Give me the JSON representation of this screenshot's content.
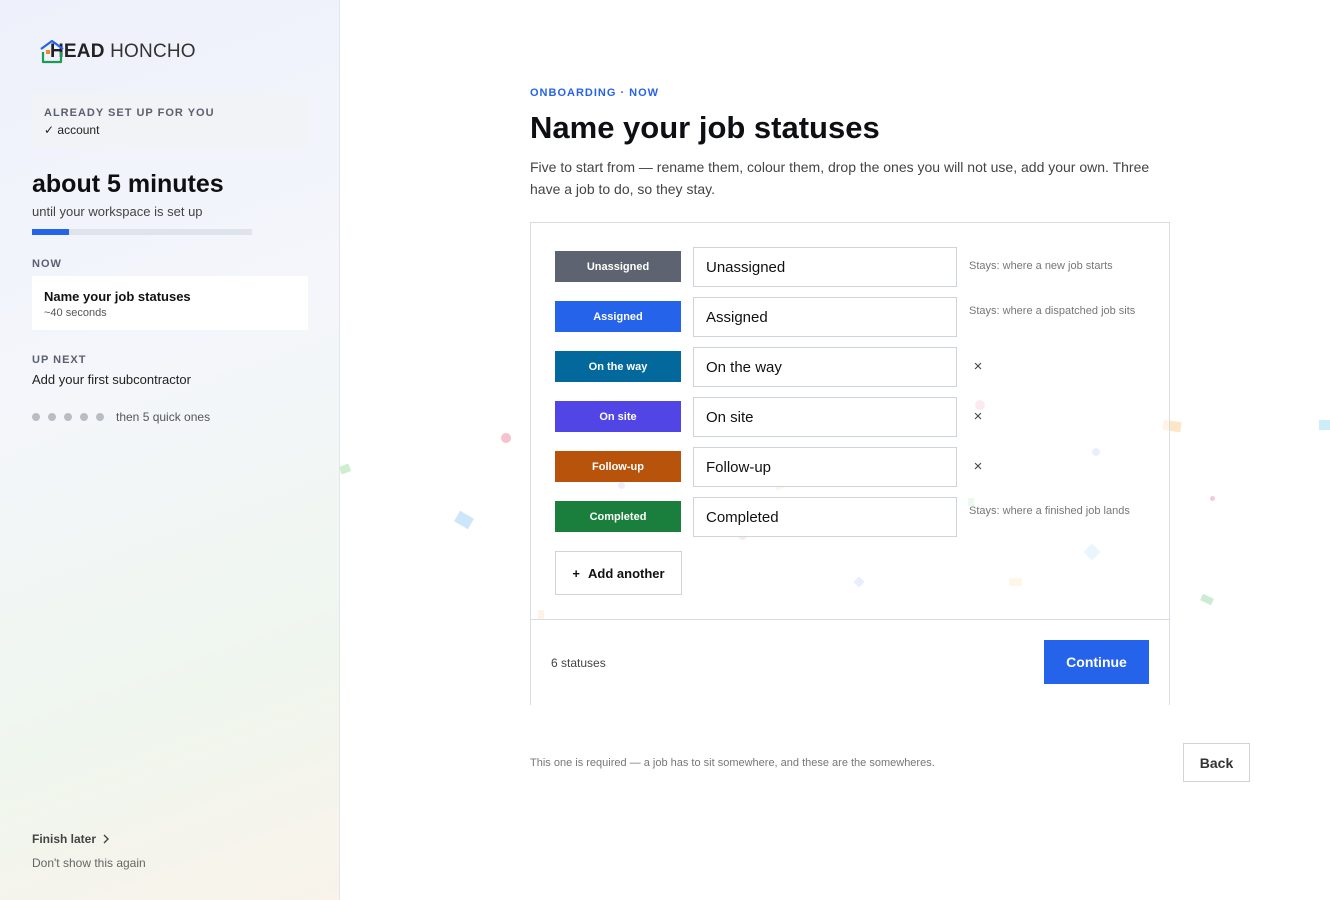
{
  "brand": {
    "bold": "HEAD",
    "light": " HONCHO"
  },
  "sidebar": {
    "setup_caption": "ALREADY SET UP FOR YOU",
    "setup_items": [
      "✓ account"
    ],
    "time_estimate": "about 5 minutes",
    "time_sub": "until your workspace is set up",
    "progress": 0.17,
    "now_caption": "NOW",
    "now_title": "Name your job statuses",
    "now_time": "~40 seconds",
    "next_caption": "UP NEXT",
    "next_title": "Add your first subcontractor",
    "remaining_text": "then 5 quick ones",
    "finish_later": "Finish later",
    "dont_show": "Don't show this again"
  },
  "main": {
    "eyebrow": "ONBOARDING · NOW",
    "title": "Name your job statuses",
    "description": "Five to start from — rename them, colour them, drop the ones you will not use, add your own. Three have a job to do, so they stay.",
    "statuses": [
      {
        "chip": "Unassigned",
        "value": "Unassigned",
        "color": "#5d6370",
        "note": "Stays: where a new job starts",
        "removable": false
      },
      {
        "chip": "Assigned",
        "value": "Assigned",
        "color": "#2563eb",
        "note": "Stays: where a dispatched job sits",
        "removable": false
      },
      {
        "chip": "On the way",
        "value": "On the way",
        "color": "#03689c",
        "note": "",
        "removable": true
      },
      {
        "chip": "On site",
        "value": "On site",
        "color": "#5146e5",
        "note": "",
        "removable": true
      },
      {
        "chip": "Follow-up",
        "value": "Follow-up",
        "color": "#b7530a",
        "note": "",
        "removable": true
      },
      {
        "chip": "Completed",
        "value": "Completed",
        "color": "#1a7f3c",
        "note": "Stays: where a finished job lands",
        "removable": false
      }
    ],
    "remove_icon": "×",
    "add_icon": "+",
    "add_label": "Add another",
    "count_label": "6 statuses",
    "continue_label": "Continue",
    "required_note": "This one is required — a job has to sit somewhere, and these are the somewheres.",
    "back_label": "Back"
  }
}
